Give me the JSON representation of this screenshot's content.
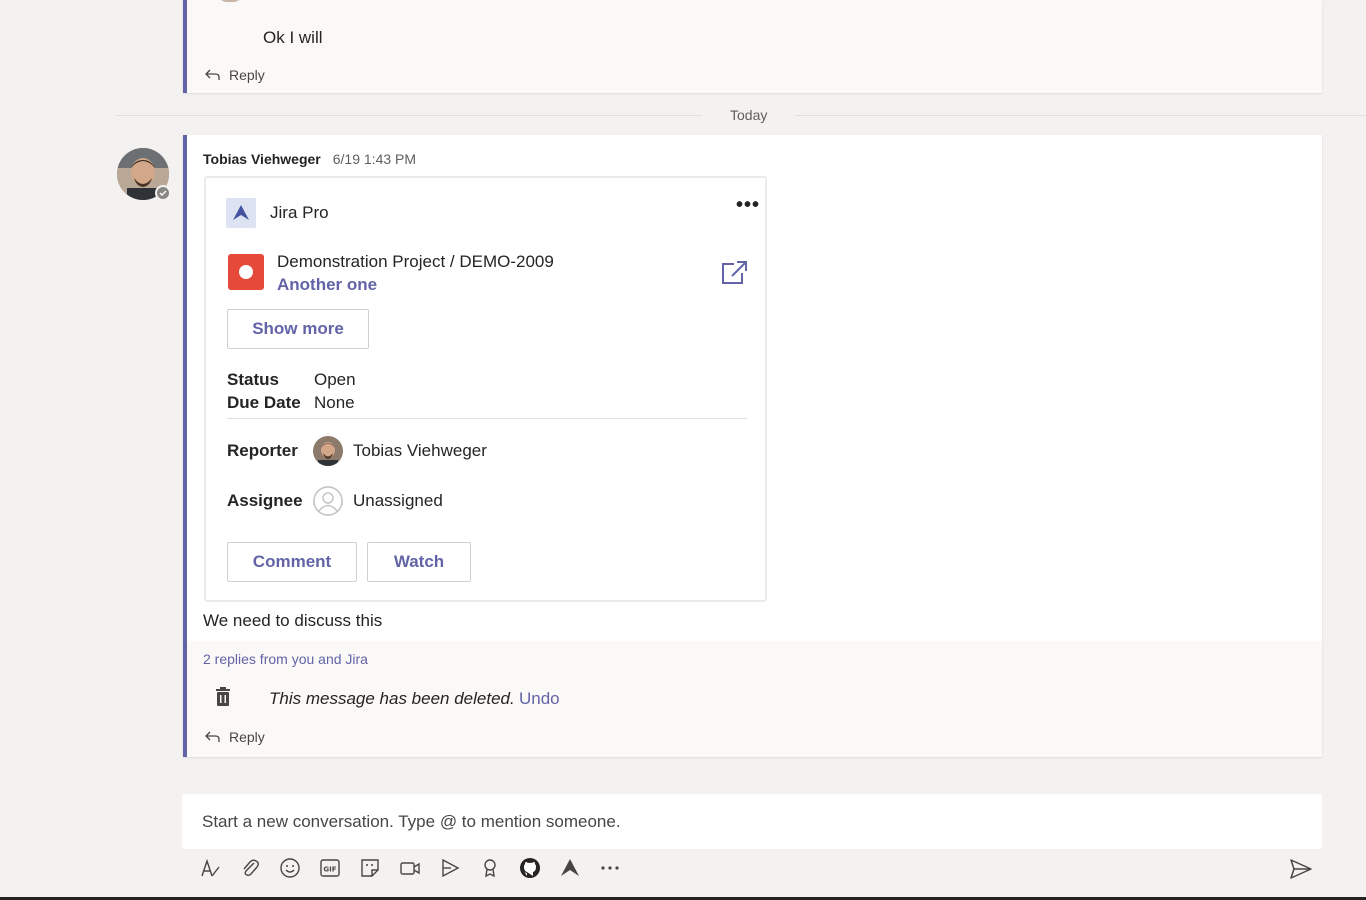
{
  "prev_thread": {
    "message": "Ok I will",
    "reply_label": "Reply"
  },
  "divider": {
    "label": "Today"
  },
  "message": {
    "author": "Tobias Viehweger",
    "time": "6/19 1:43 PM",
    "body": "We need to discuss this"
  },
  "card": {
    "app_name": "Jira Pro",
    "more_label": "•••",
    "issue_path": "Demonstration Project / DEMO-2009",
    "issue_title": "Another one",
    "show_more_label": "Show more",
    "facts": [
      {
        "key": "Status",
        "value": "Open"
      },
      {
        "key": "Due Date",
        "value": "None"
      }
    ],
    "reporter": {
      "label": "Reporter",
      "name": "Tobias Viehweger"
    },
    "assignee": {
      "label": "Assignee",
      "name": "Unassigned"
    },
    "comment_label": "Comment",
    "watch_label": "Watch"
  },
  "replies": {
    "summary": "2 replies from you and Jira",
    "deleted_text": "This message has been deleted.",
    "undo_label": "Undo",
    "reply_label": "Reply"
  },
  "compose": {
    "placeholder": "Start a new conversation. Type @ to mention someone."
  },
  "colors": {
    "accent": "#6264a7",
    "issue_red": "#e5493a",
    "background": "#f3f2f1"
  }
}
